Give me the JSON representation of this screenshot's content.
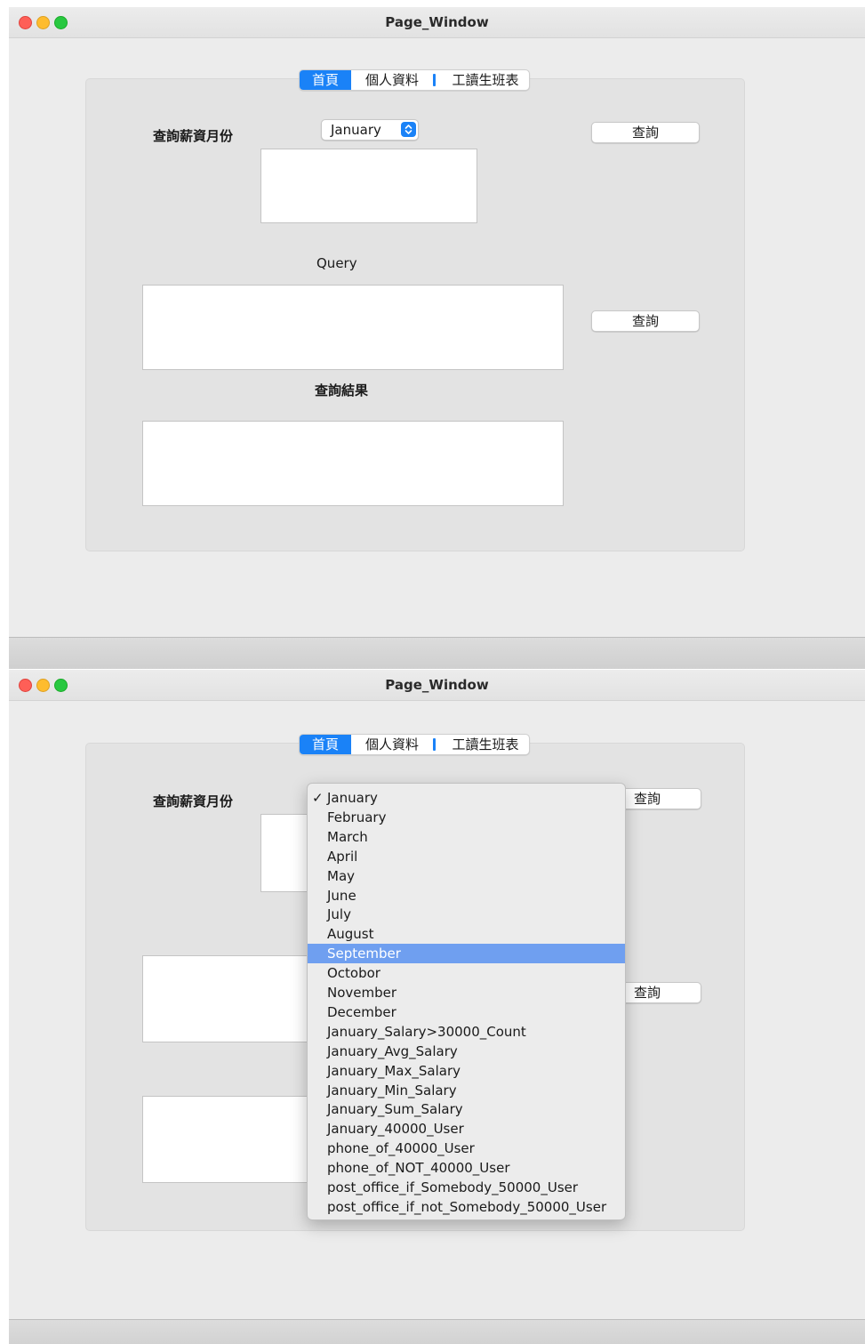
{
  "window": {
    "title": "Page_Window"
  },
  "tabs": [
    {
      "label": "首頁",
      "selected": true
    },
    {
      "label": "個人資料",
      "selected": false
    },
    {
      "label": "工讀生班表",
      "selected": false
    }
  ],
  "form": {
    "salary_month_label": "查詢薪資月份",
    "month_selected": "January",
    "query_button_label": "查詢",
    "query_label": "Query",
    "query_button2_label": "查詢",
    "result_label": "查詢結果"
  },
  "menu": {
    "checkmark": "✓",
    "highlighted": "September",
    "options": [
      "January",
      "February",
      "March",
      "April",
      "May",
      "June",
      "July",
      "August",
      "September",
      "Octobor",
      "November",
      "December",
      "January_Salary>30000_Count",
      "January_Avg_Salary",
      "January_Max_Salary",
      "January_Min_Salary",
      "January_Sum_Salary",
      "January_40000_User",
      "phone_of_40000_User",
      "phone_of_NOT_40000_User",
      "post_office_if_Somebody_50000_User",
      "post_office_if_not_Somebody_50000_User"
    ]
  },
  "colors": {
    "accent": "#1a82f7",
    "menu_highlight": "#6f9ff0"
  }
}
